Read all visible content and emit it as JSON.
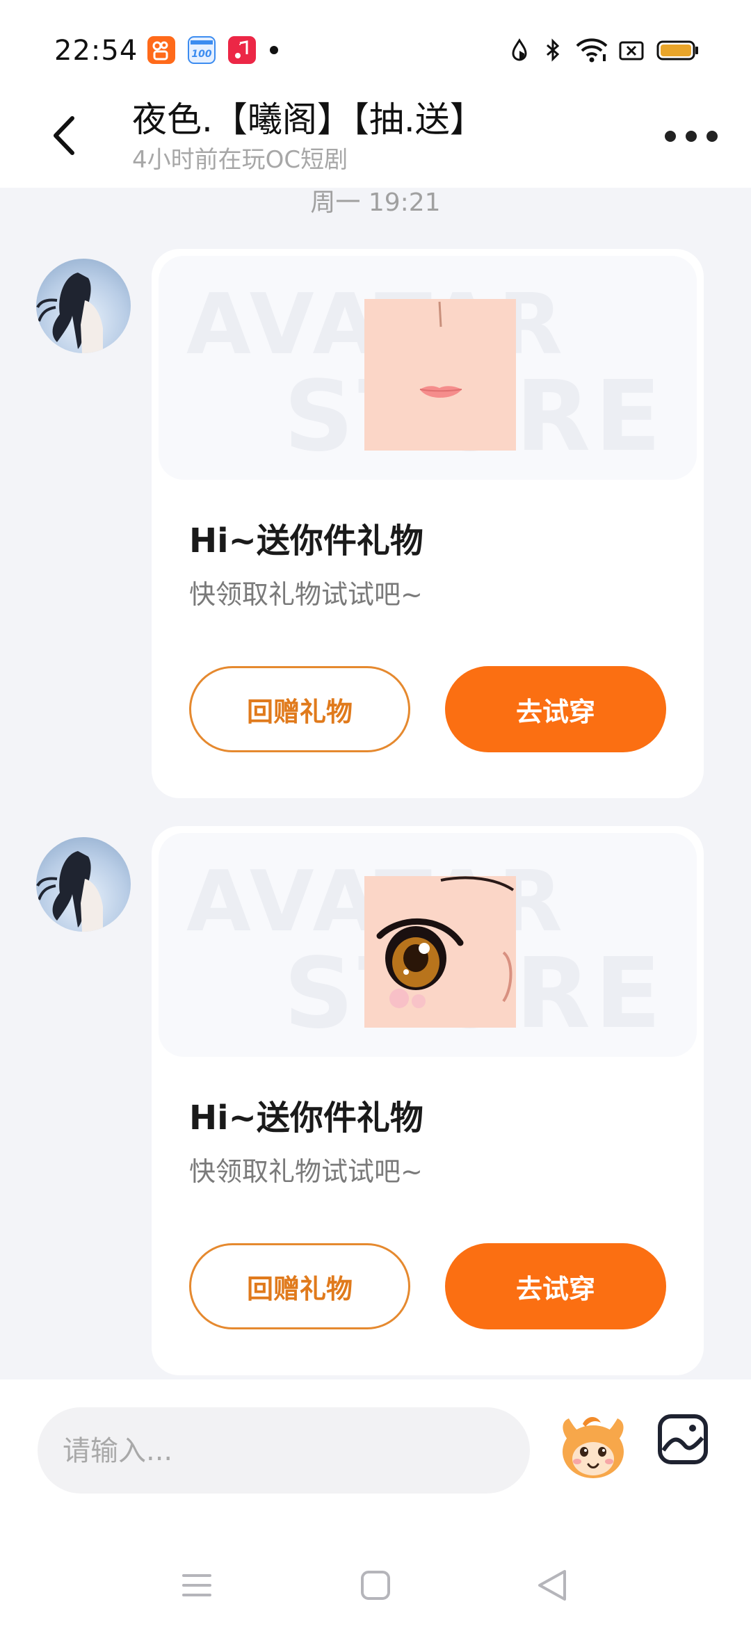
{
  "status_bar": {
    "time": "22:54",
    "app_icons": [
      {
        "name": "kuaishou-app-icon",
        "color": "#ff6a1a"
      },
      {
        "name": "score100-app-icon",
        "color": "#3c8cf0"
      },
      {
        "name": "music-app-icon",
        "color": "#ec2746"
      }
    ],
    "right_icons": [
      "drop-icon",
      "bluetooth-icon",
      "wifi-icon",
      "screen-record-icon",
      "battery-icon"
    ],
    "battery_color": "#e9a52a"
  },
  "header": {
    "back_icon": "chevron-left-icon",
    "title": "夜色.【曦阁】【抽.送】",
    "subtitle": "4小时前在玩OC短剧",
    "more_icon": "more-icon"
  },
  "chat": {
    "timestamp": "周一 19:21",
    "watermark_line1": "AVATAR",
    "watermark_line2": "STORE",
    "messages": [
      {
        "item_icon": "face-nose-lips-icon",
        "title": "Hi~送你件礼物",
        "subtitle": "快领取礼物试试吧~",
        "return_gift_label": "回赠礼物",
        "try_on_label": "去试穿"
      },
      {
        "item_icon": "face-eye-icon",
        "title": "Hi~送你件礼物",
        "subtitle": "快领取礼物试试吧~",
        "return_gift_label": "回赠礼物",
        "try_on_label": "去试穿"
      }
    ]
  },
  "input_bar": {
    "placeholder": "请输入...",
    "mascot_icon": "mascot-emoji-icon",
    "gallery_icon": "gallery-icon"
  },
  "nav_bar": {
    "icons": [
      "menu-icon",
      "home-square-icon",
      "back-triangle-icon"
    ]
  },
  "colors": {
    "accent": "#fb6f12",
    "accent_outline": "#e5892f",
    "background": "#f3f4f8"
  }
}
